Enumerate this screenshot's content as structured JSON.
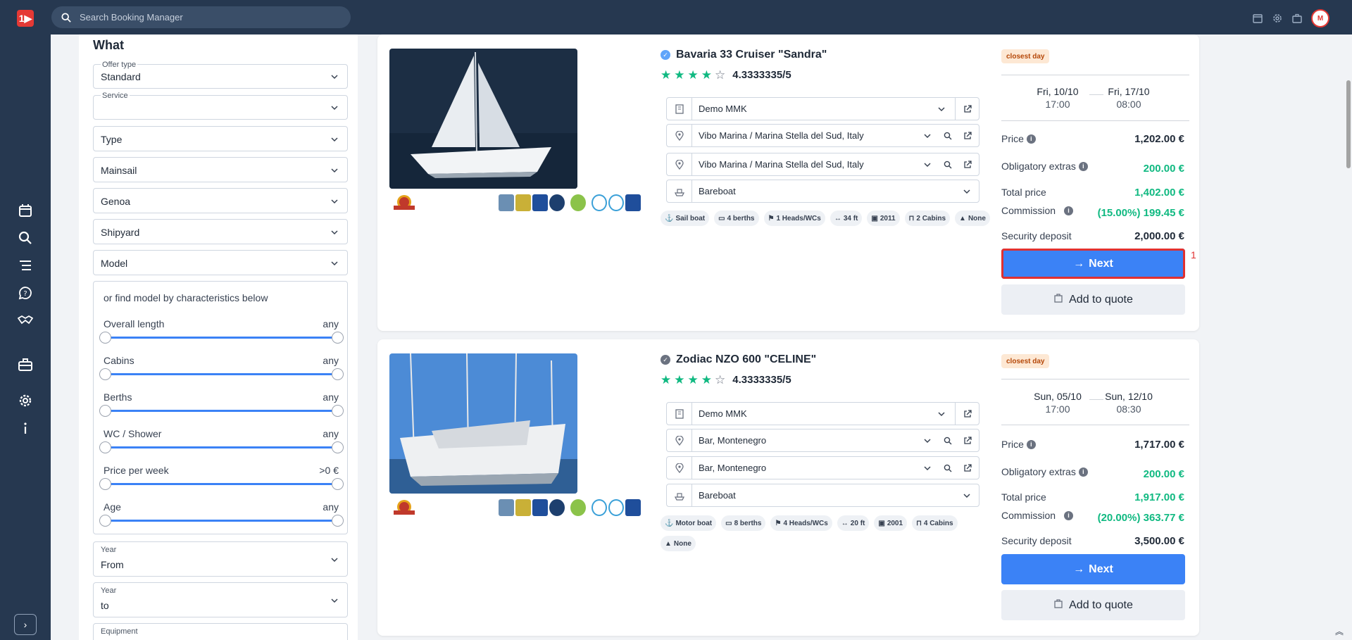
{
  "topbar": {
    "logo_text": "1▶",
    "search_placeholder": "Search Booking Manager",
    "avatar_text": "M"
  },
  "filter": {
    "title": "What",
    "offer_type": {
      "label": "Offer type",
      "value": "Standard"
    },
    "service": {
      "label": "Service",
      "value": ""
    },
    "dropdowns": [
      "Type",
      "Mainsail",
      "Genoa",
      "Shipyard",
      "Model"
    ],
    "characteristics_hint": "or find model by characteristics below",
    "sliders": [
      {
        "label": "Overall length",
        "value": "any"
      },
      {
        "label": "Cabins",
        "value": "any"
      },
      {
        "label": "Berths",
        "value": "any"
      },
      {
        "label": "WC / Shower",
        "value": "any"
      },
      {
        "label": "Price per week",
        "value": ">0 €"
      },
      {
        "label": "Age",
        "value": "any"
      }
    ],
    "year_from": {
      "label": "Year",
      "value": "From"
    },
    "year_to": {
      "label": "Year",
      "value": "to"
    },
    "equipment": {
      "label": "Equipment"
    }
  },
  "results": [
    {
      "name": "Bavaria 33 Cruiser \"Sandra\"",
      "rating_text": "4.3333335/5",
      "rating_stars": 4,
      "company": "Demo MMK",
      "base_from": "Vibo Marina / Marina Stella del Sud, Italy",
      "base_to": "Vibo Marina / Marina Stella del Sud, Italy",
      "charter_type": "Bareboat",
      "tags": [
        "Sail boat",
        "4 berths",
        "1 Heads/WCs",
        "34 ft",
        "2011",
        "2 Cabins",
        "None"
      ],
      "badge": "closest day",
      "date_from": "Fri, 10/10",
      "time_from": "17:00",
      "date_to": "Fri, 17/10",
      "time_to": "08:00",
      "price_label": "Price",
      "price": "1,202.00 €",
      "extras_label": "Obligatory extras",
      "extras": "200.00 €",
      "total_label": "Total price",
      "total": "1,402.00 €",
      "commission_label": "Commission",
      "commission": "(15.00%) 199.45 €",
      "deposit_label": "Security deposit",
      "deposit": "2,000.00 €",
      "next_label": "Next",
      "quote_label": "Add to quote"
    },
    {
      "name": "Zodiac NZO 600 \"CELINE\"",
      "rating_text": "4.3333335/5",
      "rating_stars": 4,
      "company": "Demo MMK",
      "base_from": "Bar, Montenegro",
      "base_to": "Bar, Montenegro",
      "charter_type": "Bareboat",
      "tags": [
        "Motor boat",
        "8 berths",
        "4 Heads/WCs",
        "20 ft",
        "2001",
        "4 Cabins",
        "None"
      ],
      "badge": "closest day",
      "date_from": "Sun, 05/10",
      "time_from": "17:00",
      "date_to": "Sun, 12/10",
      "time_to": "08:30",
      "price_label": "Price",
      "price": "1,717.00 €",
      "extras_label": "Obligatory extras",
      "extras": "200.00 €",
      "total_label": "Total price",
      "total": "1,917.00 €",
      "commission_label": "Commission",
      "commission": "(20.00%) 363.77 €",
      "deposit_label": "Security deposit",
      "deposit": "3,500.00 €",
      "next_label": "Next",
      "quote_label": "Add to quote"
    }
  ],
  "annotation_marker": "1",
  "colors": {
    "nav_bg": "#263850",
    "accent": "#3b82f6",
    "green": "#10b981",
    "highlight": "#e03131"
  }
}
